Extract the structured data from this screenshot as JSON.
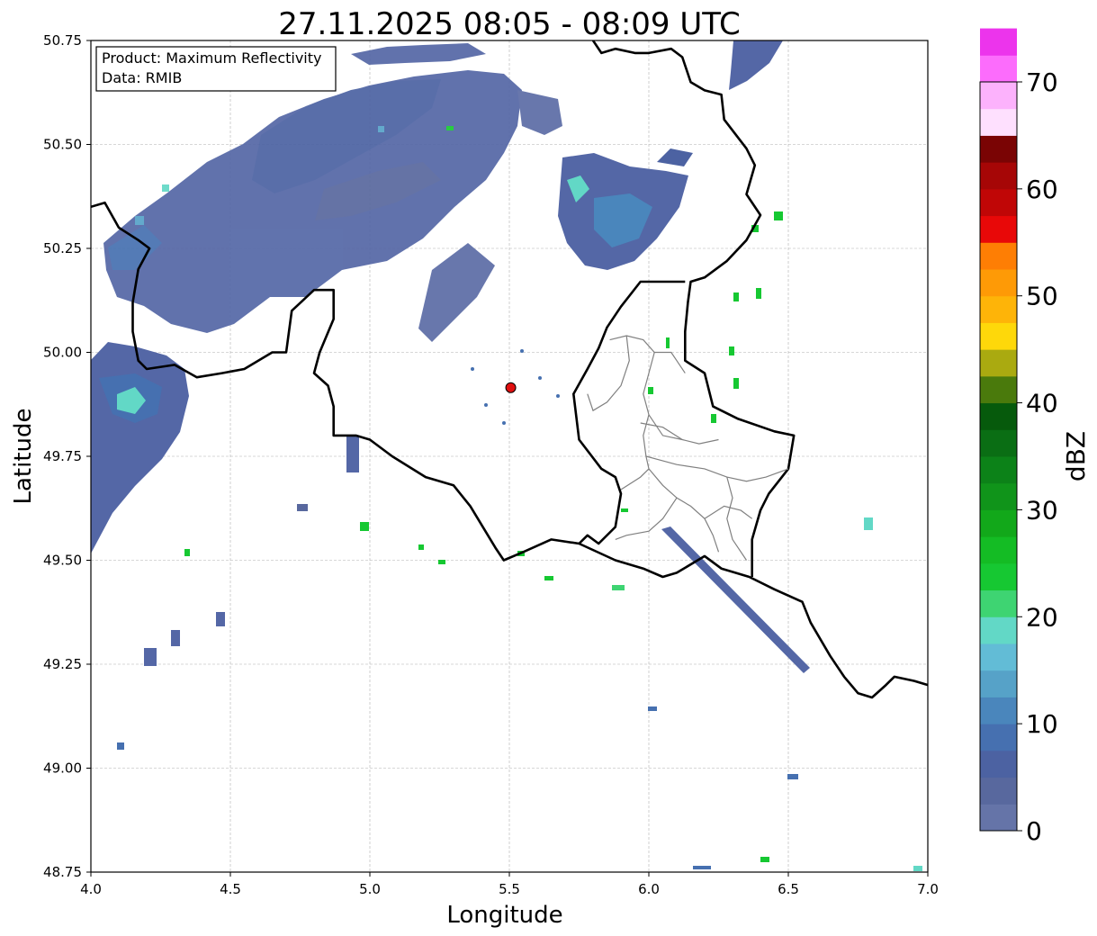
{
  "title": "27.11.2025 08:05 - 08:09 UTC",
  "info_box": {
    "product": "Product: Maximum Reflectivity",
    "data": "Data: RMIB"
  },
  "axes": {
    "xlabel": "Longitude",
    "ylabel": "Latitude",
    "xlim": [
      4.0,
      7.0
    ],
    "ylim": [
      48.75,
      50.75
    ],
    "xticks": [
      "4.0",
      "4.5",
      "5.0",
      "5.5",
      "6.0",
      "6.5",
      "7.0"
    ],
    "yticks": [
      "48.75",
      "49.00",
      "49.25",
      "49.50",
      "49.75",
      "50.00",
      "50.25",
      "50.50",
      "50.75"
    ],
    "grid": true
  },
  "radar_site": {
    "lon": 5.505,
    "lat": 49.915,
    "color": "#e01010"
  },
  "colorbar": {
    "label": "dBZ",
    "ticks": [
      "0",
      "10",
      "20",
      "30",
      "40",
      "50",
      "60",
      "70"
    ],
    "min": 0,
    "max": 70,
    "step": 2.5,
    "colors": [
      "#6574a8",
      "#58689e",
      "#4c62a2",
      "#4670b0",
      "#4a86bc",
      "#56a2c8",
      "#62bcd6",
      "#62d8c6",
      "#3ed472",
      "#16c832",
      "#14bc24",
      "#12a81a",
      "#10941a",
      "#0c8218",
      "#0a6e14",
      "#065a0c",
      "#4a7a0c",
      "#aaaa10",
      "#fed80a",
      "#feb408",
      "#fe9a06",
      "#fe7e04",
      "#e80808",
      "#c00606",
      "#a60606",
      "#7a0404",
      "#fee0fe",
      "#fcb2fc",
      "#fc6cfc",
      "#ec34ec"
    ]
  },
  "chart_data": {
    "type": "heatmap",
    "title": "27.11.2025 08:05 - 08:09 UTC",
    "xlabel": "Longitude",
    "ylabel": "Latitude",
    "xlim": [
      4.0,
      7.0
    ],
    "ylim": [
      48.75,
      50.75
    ],
    "value_label": "dBZ",
    "value_range": [
      0,
      70
    ],
    "radar_site": [
      5.505,
      49.915
    ],
    "echo_areas": [
      {
        "lon": [
          4.05,
          5.9
        ],
        "lat": [
          50.05,
          50.75
        ],
        "dbz": [
          2,
          12
        ]
      },
      {
        "lon": [
          4.0,
          4.35
        ],
        "lat": [
          49.55,
          50.05
        ],
        "dbz": [
          2,
          16
        ]
      },
      {
        "lon": [
          6.2,
          6.55
        ],
        "lat": [
          50.15,
          50.4
        ],
        "dbz": [
          2,
          16
        ]
      },
      {
        "lon": [
          6.05,
          6.6
        ],
        "lat": [
          49.22,
          49.5
        ],
        "dbz": [
          2,
          6
        ]
      }
    ]
  },
  "borders": {
    "country": [
      [
        [
          4.0,
          50.35
        ],
        [
          4.05,
          50.36
        ],
        [
          4.1,
          50.3
        ],
        [
          4.17,
          50.27
        ],
        [
          4.21,
          50.25
        ],
        [
          4.17,
          50.2
        ],
        [
          4.15,
          50.12
        ],
        [
          4.15,
          50.05
        ],
        [
          4.17,
          49.98
        ],
        [
          4.2,
          49.96
        ],
        [
          4.3,
          49.97
        ],
        [
          4.38,
          49.94
        ],
        [
          4.47,
          49.95
        ],
        [
          4.55,
          49.96
        ],
        [
          4.6,
          49.98
        ],
        [
          4.65,
          50.0
        ],
        [
          4.7,
          50.0
        ],
        [
          4.72,
          50.1
        ],
        [
          4.8,
          50.15
        ],
        [
          4.87,
          50.15
        ],
        [
          4.87,
          50.08
        ],
        [
          4.82,
          50.0
        ],
        [
          4.8,
          49.95
        ],
        [
          4.85,
          49.92
        ],
        [
          4.87,
          49.87
        ],
        [
          4.87,
          49.8
        ],
        [
          4.95,
          49.8
        ],
        [
          5.0,
          49.79
        ],
        [
          5.08,
          49.75
        ],
        [
          5.2,
          49.7
        ],
        [
          5.3,
          49.68
        ],
        [
          5.36,
          49.63
        ],
        [
          5.45,
          49.53
        ],
        [
          5.48,
          49.5
        ],
        [
          5.55,
          49.52
        ],
        [
          5.65,
          49.55
        ],
        [
          5.75,
          49.54
        ],
        [
          5.88,
          49.5
        ],
        [
          5.98,
          49.48
        ],
        [
          6.05,
          49.46
        ],
        [
          6.1,
          49.47
        ],
        [
          6.2,
          49.51
        ],
        [
          6.26,
          49.48
        ],
        [
          6.36,
          49.46
        ],
        [
          6.45,
          49.43
        ],
        [
          6.55,
          49.4
        ],
        [
          6.58,
          49.35
        ],
        [
          6.65,
          49.27
        ],
        [
          6.7,
          49.22
        ],
        [
          6.75,
          49.18
        ],
        [
          6.8,
          49.17
        ],
        [
          6.85,
          49.2
        ],
        [
          6.88,
          49.22
        ],
        [
          6.95,
          49.21
        ],
        [
          7.0,
          49.2
        ]
      ],
      [
        [
          5.8,
          50.75
        ],
        [
          5.83,
          50.72
        ],
        [
          5.88,
          50.73
        ],
        [
          5.95,
          50.72
        ],
        [
          6.0,
          50.72
        ],
        [
          6.08,
          50.73
        ],
        [
          6.12,
          50.71
        ],
        [
          6.15,
          50.65
        ],
        [
          6.2,
          50.63
        ],
        [
          6.26,
          50.62
        ],
        [
          6.27,
          50.56
        ],
        [
          6.35,
          50.49
        ],
        [
          6.38,
          50.45
        ],
        [
          6.35,
          50.38
        ],
        [
          6.4,
          50.33
        ],
        [
          6.35,
          50.27
        ],
        [
          6.28,
          50.22
        ],
        [
          6.2,
          50.18
        ],
        [
          6.15,
          50.17
        ],
        [
          6.14,
          50.12
        ],
        [
          6.13,
          50.05
        ],
        [
          6.13,
          49.98
        ],
        [
          6.2,
          49.95
        ],
        [
          6.23,
          49.87
        ],
        [
          6.32,
          49.84
        ],
        [
          6.45,
          49.81
        ],
        [
          6.52,
          49.8
        ],
        [
          6.5,
          49.72
        ],
        [
          6.43,
          49.66
        ],
        [
          6.4,
          49.62
        ],
        [
          6.37,
          49.55
        ],
        [
          6.37,
          49.46
        ]
      ],
      [
        [
          6.13,
          50.17
        ],
        [
          6.05,
          50.17
        ],
        [
          5.97,
          50.17
        ],
        [
          5.9,
          50.11
        ],
        [
          5.85,
          50.06
        ],
        [
          5.82,
          50.01
        ],
        [
          5.78,
          49.96
        ],
        [
          5.73,
          49.9
        ],
        [
          5.75,
          49.79
        ],
        [
          5.83,
          49.72
        ],
        [
          5.88,
          49.7
        ],
        [
          5.9,
          49.66
        ],
        [
          5.88,
          49.58
        ],
        [
          5.82,
          49.54
        ],
        [
          5.78,
          49.56
        ],
        [
          5.75,
          49.54
        ]
      ]
    ],
    "provinces": [
      [
        [
          5.86,
          50.03
        ],
        [
          5.92,
          50.04
        ],
        [
          5.98,
          50.03
        ],
        [
          6.02,
          50.0
        ],
        [
          6.08,
          50.0
        ],
        [
          6.1,
          49.98
        ],
        [
          6.13,
          49.95
        ]
      ],
      [
        [
          5.92,
          50.04
        ],
        [
          5.93,
          49.98
        ],
        [
          5.9,
          49.92
        ],
        [
          5.85,
          49.88
        ],
        [
          5.8,
          49.86
        ],
        [
          5.78,
          49.9
        ]
      ],
      [
        [
          6.02,
          50.0
        ],
        [
          6.0,
          49.95
        ],
        [
          5.98,
          49.9
        ],
        [
          6.0,
          49.85
        ],
        [
          6.05,
          49.8
        ],
        [
          6.12,
          49.79
        ],
        [
          6.18,
          49.78
        ],
        [
          6.25,
          49.79
        ]
      ],
      [
        [
          5.97,
          49.83
        ],
        [
          6.05,
          49.82
        ],
        [
          6.12,
          49.79
        ]
      ],
      [
        [
          6.0,
          49.85
        ],
        [
          5.98,
          49.8
        ],
        [
          5.99,
          49.75
        ],
        [
          6.0,
          49.72
        ],
        [
          5.97,
          49.7
        ],
        [
          5.9,
          49.67
        ]
      ],
      [
        [
          5.99,
          49.75
        ],
        [
          6.1,
          49.73
        ],
        [
          6.2,
          49.72
        ],
        [
          6.28,
          49.7
        ],
        [
          6.35,
          49.69
        ],
        [
          6.42,
          49.7
        ],
        [
          6.5,
          49.72
        ]
      ],
      [
        [
          6.0,
          49.72
        ],
        [
          6.05,
          49.68
        ],
        [
          6.1,
          49.65
        ],
        [
          6.15,
          49.63
        ],
        [
          6.2,
          49.6
        ],
        [
          6.23,
          49.56
        ],
        [
          6.25,
          49.52
        ]
      ],
      [
        [
          6.1,
          49.65
        ],
        [
          6.05,
          49.6
        ],
        [
          6.0,
          49.57
        ],
        [
          5.92,
          49.56
        ],
        [
          5.88,
          49.55
        ]
      ],
      [
        [
          6.2,
          49.6
        ],
        [
          6.27,
          49.63
        ],
        [
          6.33,
          49.62
        ],
        [
          6.37,
          49.6
        ]
      ],
      [
        [
          6.28,
          49.7
        ],
        [
          6.3,
          49.65
        ],
        [
          6.28,
          49.6
        ],
        [
          6.3,
          49.55
        ],
        [
          6.35,
          49.5
        ]
      ]
    ]
  }
}
